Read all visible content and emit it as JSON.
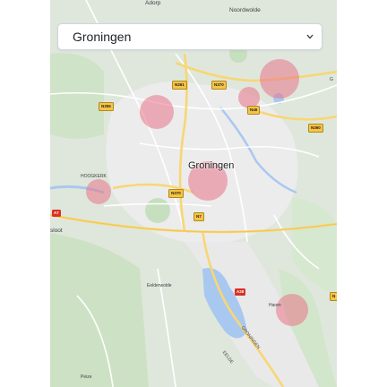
{
  "location_select": {
    "value": "Groningen"
  },
  "map": {
    "labels": {
      "adorp": "Adorp",
      "noordwolde": "Noordwolde",
      "groningen": "Groningen",
      "hoogkerk": "HOOGKERK",
      "sloot": "sloot",
      "eelderwolde": "Eelderwolde",
      "haren": "Haren",
      "peize": "Peize",
      "g": "G",
      "groningen_airport": "GRONINGEN",
      "eelde_airport": "EELDE"
    },
    "road_shields": {
      "n361": "N361",
      "n370a": "N370",
      "n355": "N355",
      "n46": "N46",
      "n360": "N360",
      "n370b": "N370",
      "n7": "N7",
      "a7": "A7",
      "a28": "A28",
      "n": "N"
    }
  },
  "colors": {
    "marker": "#e8758a",
    "shield_yellow": "#f6c343",
    "shield_red": "#d93025"
  }
}
